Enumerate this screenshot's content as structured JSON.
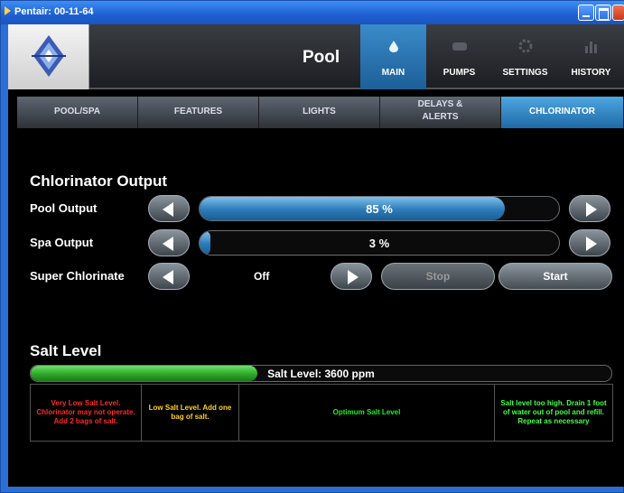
{
  "window": {
    "title": "Pentair: 00-11-64"
  },
  "header": {
    "title": "Pool",
    "nav": [
      {
        "label": "MAIN",
        "icon": "water-drop-icon",
        "active": true
      },
      {
        "label": "PUMPS",
        "icon": "pump-icon",
        "active": false
      },
      {
        "label": "SETTINGS",
        "icon": "gear-icon",
        "active": false
      },
      {
        "label": "HISTORY",
        "icon": "bar-chart-icon",
        "active": false
      }
    ]
  },
  "subtabs": [
    {
      "label": "POOL/SPA"
    },
    {
      "label": "FEATURES"
    },
    {
      "label": "LIGHTS"
    },
    {
      "label_line1": "DELAYS &",
      "label_line2": "ALERTS"
    },
    {
      "label": "CHLORINATOR",
      "active": true
    }
  ],
  "chlorinator": {
    "title": "Chlorinator Output",
    "pool_output": {
      "label": "Pool Output",
      "value": 85,
      "text": "85 %"
    },
    "spa_output": {
      "label": "Spa Output",
      "value": 3,
      "text": "3 %"
    },
    "super_chlorinate": {
      "label": "Super Chlorinate",
      "value": "Off",
      "stop_label": "Stop",
      "start_label": "Start"
    }
  },
  "salt": {
    "title": "Salt Level",
    "bar_label": "Salt Level: ",
    "bar_value": "3600",
    "bar_unit": " ppm",
    "fill_fraction": 0.39,
    "legend": [
      {
        "text": "Very Low Salt Level. Chlorinator may not operate. Add 2 bags of salt.",
        "color": "#ff2a2a"
      },
      {
        "text": "Low Salt Level. Add one bag of salt.",
        "color": "#ffd21a"
      },
      {
        "text": "Optimum Salt Level",
        "color": "#22ee22"
      },
      {
        "text": "Salt level too high. Drain 1 foot of water out of pool and refill. Repeat as necessary",
        "color": "#44ff44"
      }
    ]
  }
}
